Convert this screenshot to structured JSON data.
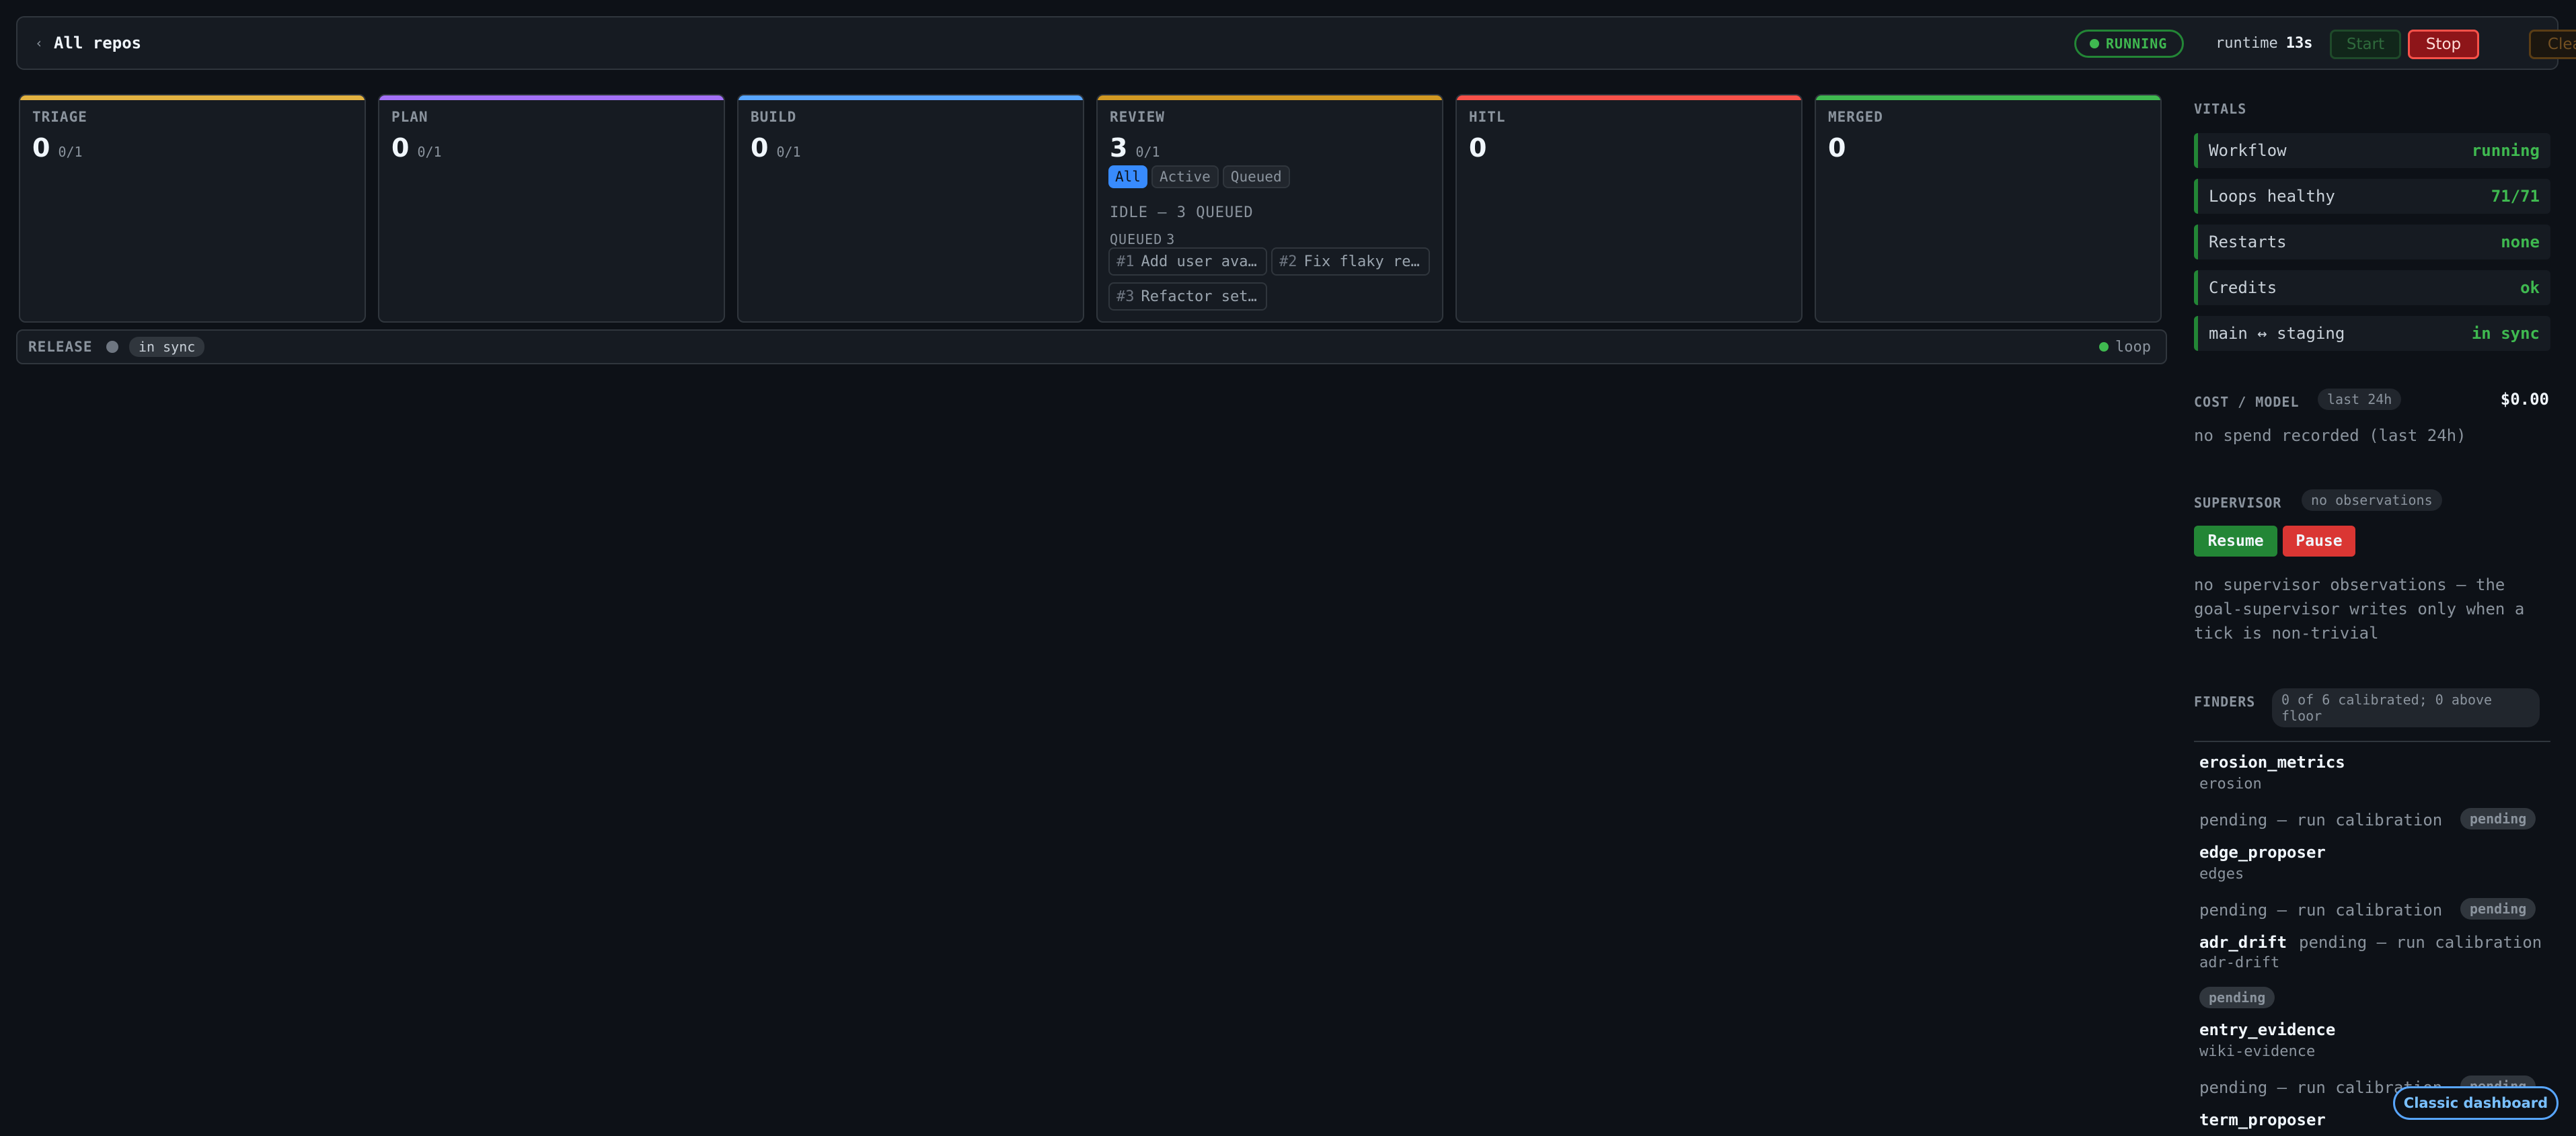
{
  "header": {
    "back_label": "All repos",
    "status": "RUNNING",
    "runtime_label": "runtime",
    "runtime_value": "13s",
    "start_label": "Start",
    "stop_label": "Stop",
    "clear_label": "Clear"
  },
  "stages": [
    {
      "label": "TRIAGE",
      "count": "0",
      "capacity": "0/1",
      "accent": "#e3b341"
    },
    {
      "label": "PLAN",
      "count": "0",
      "capacity": "0/1",
      "accent": "#a371f7"
    },
    {
      "label": "BUILD",
      "count": "0",
      "capacity": "0/1",
      "accent": "#58a6ff"
    },
    {
      "label": "REVIEW",
      "count": "3",
      "capacity": "0/1",
      "accent": "#d29922"
    },
    {
      "label": "HITL",
      "count": "0",
      "capacity": "",
      "accent": "#f85149"
    },
    {
      "label": "MERGED",
      "count": "0",
      "capacity": "",
      "accent": "#3fb950"
    }
  ],
  "review": {
    "filters": [
      "All",
      "Active",
      "Queued"
    ],
    "idle_text": "IDLE — 3 QUEUED",
    "queued_label": "QUEUED",
    "queued_count": "3",
    "items": [
      {
        "num": "#1",
        "title": "Add user avatars"
      },
      {
        "num": "#2",
        "title": "Fix flaky release test"
      },
      {
        "num": "#3",
        "title": "Refactor settings page"
      }
    ]
  },
  "release": {
    "label": "RELEASE",
    "status": "in sync",
    "loop_label": "loop"
  },
  "vitals": {
    "title": "VITALS",
    "items": [
      {
        "key": "Workflow",
        "value": "running"
      },
      {
        "key": "Loops healthy",
        "value": "71/71"
      },
      {
        "key": "Restarts",
        "value": "none"
      },
      {
        "key": "Credits",
        "value": "ok"
      },
      {
        "key": "main ↔ staging",
        "value": "in sync"
      }
    ]
  },
  "cost": {
    "title": "COST / MODEL",
    "window": "last 24h",
    "total": "$0.00",
    "empty_text": "no spend recorded (last 24h)"
  },
  "supervisor": {
    "title": "SUPERVISOR",
    "badge": "no observations",
    "resume_label": "Resume",
    "pause_label": "Pause",
    "note": "no supervisor observations — the goal-supervisor writes only when a tick is non-trivial"
  },
  "finders": {
    "title": "FINDERS",
    "summary": "0 of 6 calibrated; 0 above floor",
    "items": [
      {
        "name": "erosion_metrics",
        "sub": "erosion",
        "status": "pending — run calibration",
        "tag": "pending"
      },
      {
        "name": "edge_proposer",
        "sub": "edges",
        "status": "pending — run calibration",
        "tag": "pending"
      },
      {
        "name": "adr_drift",
        "sub": "adr-drift",
        "status": "pending — run calibration",
        "tag": "pending"
      },
      {
        "name": "entry_evidence",
        "sub": "wiki-evidence",
        "status": "pending — run calibration",
        "tag": "pending"
      },
      {
        "name": "term_proposer",
        "sub": "",
        "status": "",
        "tag": ""
      }
    ]
  },
  "footer": {
    "classic_label": "Classic dashboard"
  }
}
